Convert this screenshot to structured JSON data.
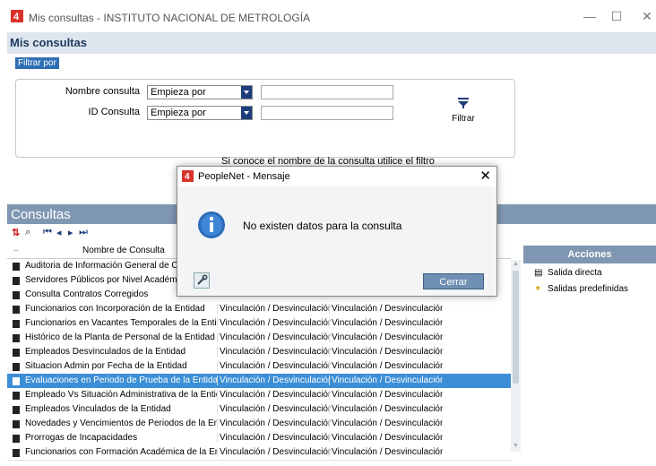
{
  "window": {
    "title": "Mis consultas - INSTITUTO NACIONAL DE METROLOGÍA",
    "minimize": "—",
    "maximize": "☐",
    "close": "✕"
  },
  "page": {
    "title": "Mis consultas",
    "filter_tag": "Filtrar por"
  },
  "filter": {
    "name_label": "Nombre consulta",
    "name_operator": "Empieza por",
    "name_value": "",
    "id_label": "ID Consulta",
    "id_operator": "Empieza por",
    "id_value": "",
    "button_label": "Filtrar"
  },
  "hint": "Si conoce el nombre de la consulta utilice el filtro",
  "consultas": {
    "title": "Consultas",
    "column_header": "Nombre de Consulta",
    "rows": [
      {
        "name": "Auditoria de Información General de Contrato",
        "c2": "",
        "c3": ""
      },
      {
        "name": "Servidores Públicos por Nivel Académico y C",
        "c2": "",
        "c3": ""
      },
      {
        "name": "Consulta Contratos Corregidos",
        "c2": "",
        "c3": ""
      },
      {
        "name": "Funcionarios con Incorporación de la Entidad",
        "c2": "Vinculación / Desvinculación",
        "c3": "Vinculación / Desvinculación"
      },
      {
        "name": "Funcionarios en Vacantes Temporales de la Entidad",
        "c2": "Vinculación / Desvinculación",
        "c3": "Vinculación / Desvinculación"
      },
      {
        "name": "Histórico de la Planta de Personal de la Entidad",
        "c2": "Vinculación / Desvinculación",
        "c3": "Vinculación / Desvinculación"
      },
      {
        "name": "Empleados Desvinculados de la Entidad",
        "c2": "Vinculación / Desvinculación",
        "c3": "Vinculación / Desvinculación"
      },
      {
        "name": "Situacion Admin por Fecha de la Entidad",
        "c2": "Vinculación / Desvinculación",
        "c3": "Vinculación / Desvinculación"
      },
      {
        "name": "Evaluaciones en Periodo de Prueba de la Entidad",
        "c2": "Vinculación / Desvinculación",
        "c3": "Vinculación / Desvinculación",
        "selected": true
      },
      {
        "name": "Empleado Vs Situación Administrativa de la Entidad",
        "c2": "Vinculación / Desvinculación",
        "c3": "Vinculación / Desvinculación"
      },
      {
        "name": "Empleados Vinculados de la Entidad",
        "c2": "Vinculación / Desvinculación",
        "c3": "Vinculación / Desvinculación"
      },
      {
        "name": "Novedades y Vencimientos de Periodos de la Entidad",
        "c2": "Vinculación / Desvinculación",
        "c3": "Vinculación / Desvinculación"
      },
      {
        "name": "Prorrogas de Incapacidades",
        "c2": "Vinculación / Desvinculación",
        "c3": "Vinculación / Desvinculación"
      },
      {
        "name": "Funcionarios con Formación Académica de la Entidad",
        "c2": "Vinculación / Desvinculación",
        "c3": "Vinculación / Desvinculación"
      }
    ]
  },
  "acciones": {
    "title": "Acciones",
    "items": [
      "Salida directa",
      "Salidas predefinidas"
    ]
  },
  "modal": {
    "title": "PeopleNet - Mensaje",
    "close": "✕",
    "message": "No existen datos para la consulta",
    "button": "Cerrar"
  },
  "colors": {
    "accent": "#7f97b2",
    "selected_row": "#3c8fd6",
    "logo_red": "#d9322a"
  }
}
